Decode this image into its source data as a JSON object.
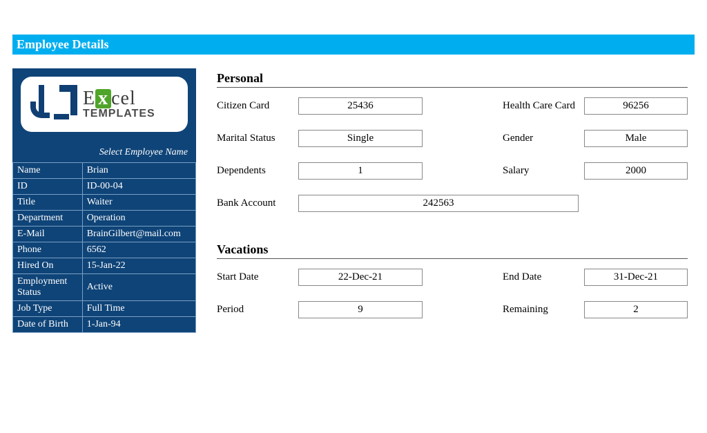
{
  "header": {
    "title": "Employee Details"
  },
  "sidebar": {
    "logo": {
      "brand1": "E",
      "brand_x": "x",
      "brand2": "cel",
      "sub": "TEMPLATES"
    },
    "select_label": "Select Employee Name",
    "rows": [
      {
        "label": "Name",
        "value": "Brian"
      },
      {
        "label": "ID",
        "value": "ID-00-04"
      },
      {
        "label": "Title",
        "value": "Waiter"
      },
      {
        "label": "Department",
        "value": "Operation"
      },
      {
        "label": "E-Mail",
        "value": "BrainGilbert@mail.com"
      },
      {
        "label": "Phone",
        "value": "6562"
      },
      {
        "label": "Hired On",
        "value": "15-Jan-22"
      },
      {
        "label": "Employment Status",
        "value": "Active"
      },
      {
        "label": "Job Type",
        "value": "Full Time"
      },
      {
        "label": "Date of Birth",
        "value": "1-Jan-94"
      }
    ]
  },
  "personal": {
    "title": "Personal",
    "citizen_card_label": "Citizen Card",
    "citizen_card": "25436",
    "health_care_label": "Health Care Card",
    "health_care": "96256",
    "marital_status_label": "Marital Status",
    "marital_status": "Single",
    "gender_label": "Gender",
    "gender": "Male",
    "dependents_label": "Dependents",
    "dependents": "1",
    "salary_label": "Salary",
    "salary": "2000",
    "bank_account_label": "Bank Account",
    "bank_account": "242563"
  },
  "vacations": {
    "title": "Vacations",
    "start_date_label": "Start Date",
    "start_date": "22-Dec-21",
    "end_date_label": "End Date",
    "end_date": "31-Dec-21",
    "period_label": "Period",
    "period": "9",
    "remaining_label": "Remaining",
    "remaining": "2"
  }
}
